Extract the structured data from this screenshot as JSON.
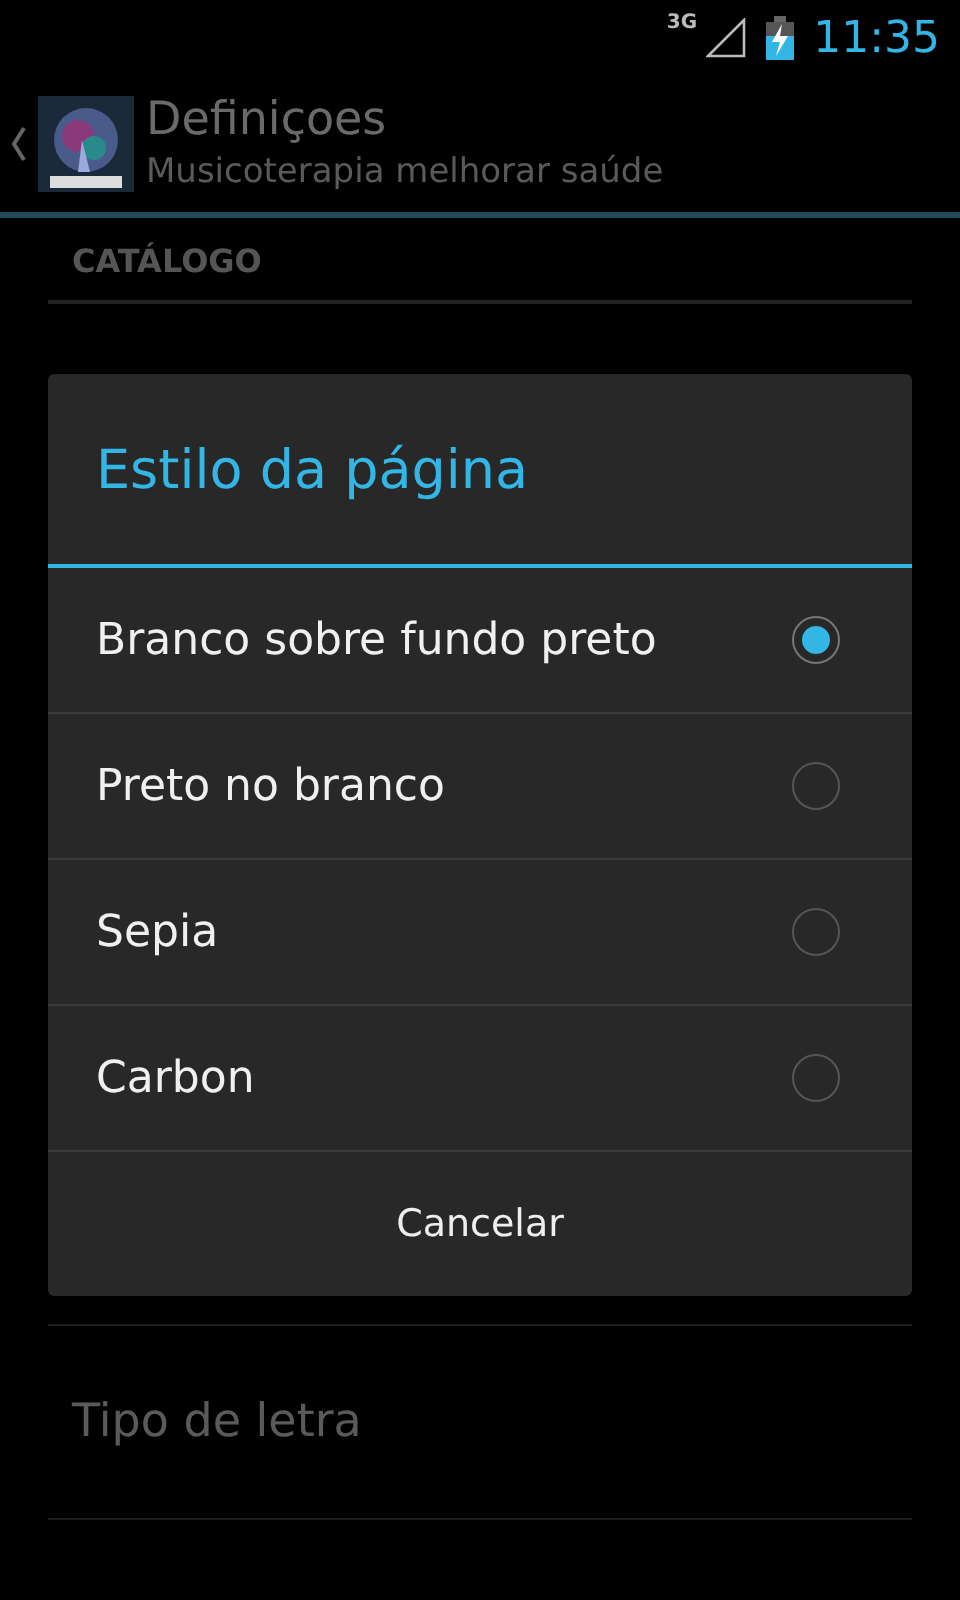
{
  "status_bar": {
    "network": "3G",
    "time": "11:35"
  },
  "action_bar": {
    "title": "Definiçoes",
    "subtitle": "Musicoterapia melhorar saúde"
  },
  "settings": {
    "section": "CATÁLOGO",
    "items": [
      "Tipo de letra"
    ]
  },
  "dialog": {
    "title": "Estilo da página",
    "options": [
      {
        "label": "Branco sobre fundo preto",
        "selected": true
      },
      {
        "label": "Preto no branco",
        "selected": false
      },
      {
        "label": "Sepia",
        "selected": false
      },
      {
        "label": "Carbon",
        "selected": false
      }
    ],
    "cancel": "Cancelar"
  }
}
